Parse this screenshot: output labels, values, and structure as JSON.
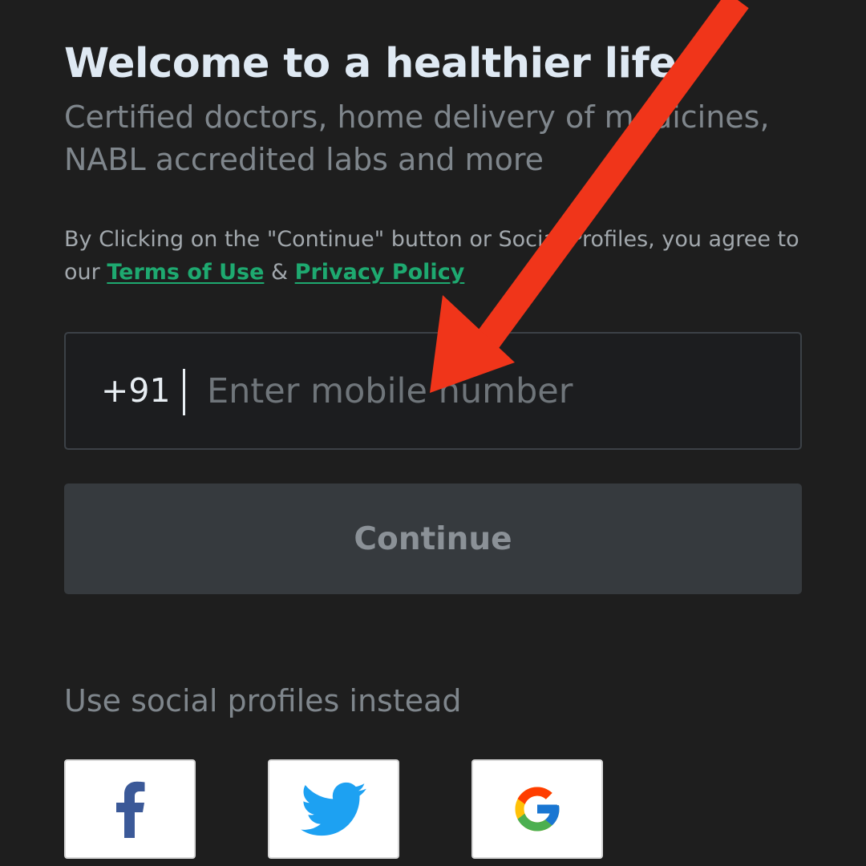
{
  "header": {
    "title": "Welcome to a healthier life",
    "subtitle": "Certified doctors, home delivery of medicines, NABL accredited labs and more"
  },
  "terms": {
    "prefix": "By Clicking on the \"Continue\" button or Social Profiles, you agree to our",
    "terms_link": "Terms of Use",
    "separator": "&",
    "privacy_link": "Privacy Policy"
  },
  "phone": {
    "country_code": "+91",
    "placeholder": "Enter mobile number",
    "value": ""
  },
  "continue_button": {
    "label": "Continue"
  },
  "social": {
    "heading": "Use social profiles instead",
    "providers": [
      "facebook",
      "twitter",
      "google"
    ]
  },
  "colors": {
    "background": "#1e1e1e",
    "link": "#1ea970",
    "annotation_arrow": "#f0351a",
    "facebook": "#3b5998",
    "twitter": "#1da1f2"
  },
  "icons": [
    "facebook-icon",
    "twitter-icon",
    "google-icon",
    "annotation-arrow"
  ]
}
